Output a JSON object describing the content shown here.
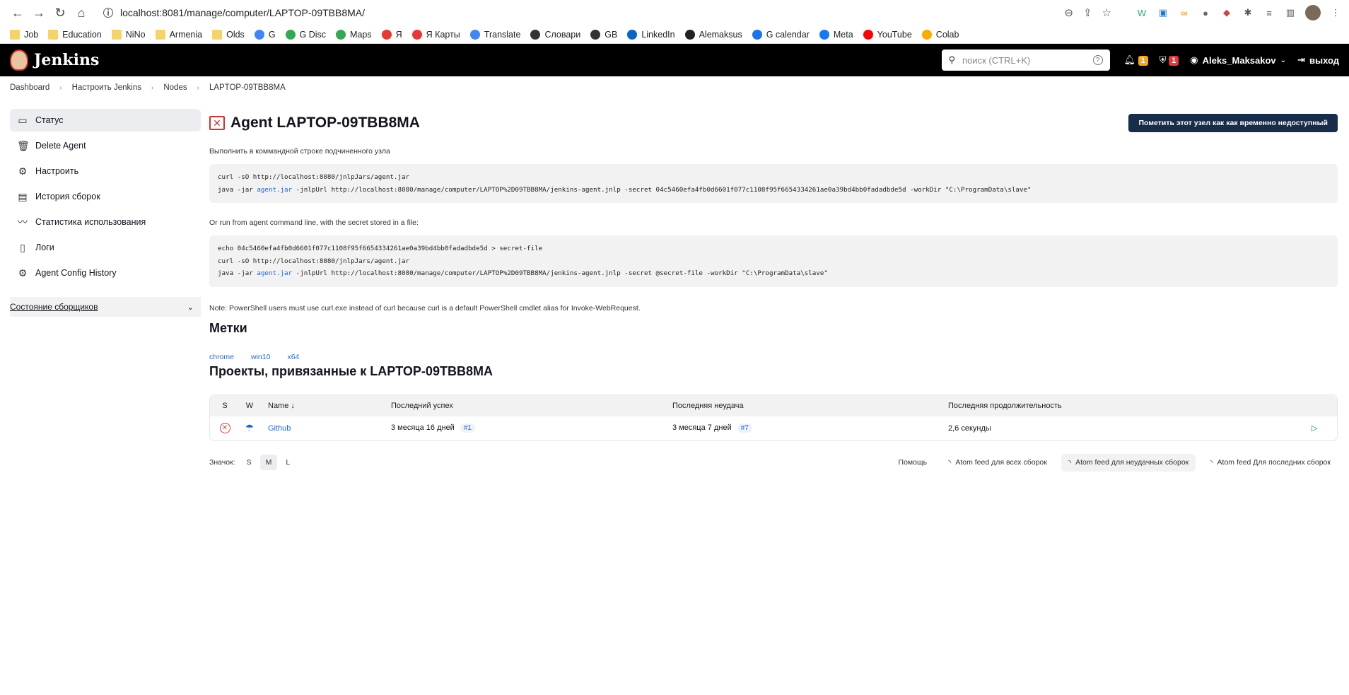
{
  "browser": {
    "url": "localhost:8081/manage/computer/LAPTOP-09TBB8MA/",
    "bookmarks": [
      "Job",
      "Education",
      "NiNo",
      "Armenia",
      "Olds",
      "G",
      "G Disc",
      "Maps",
      "Я",
      "Я Карты",
      "Translate",
      "Словари",
      "GB",
      "LinkedIn",
      "Alemaksus",
      "G calendar",
      "Meta",
      "YouTube",
      "Colab"
    ]
  },
  "header": {
    "app_name": "Jenkins",
    "search_placeholder": "поиск (CTRL+K)",
    "notifications_count": "1",
    "security_count": "1",
    "user": "Aleks_Maksakov",
    "logout": "выход"
  },
  "breadcrumb": [
    "Dashboard",
    "Настроить Jenkins",
    "Nodes",
    "LAPTOP-09TBB8MA"
  ],
  "sidebar": {
    "items": [
      {
        "label": "Статус",
        "icon": "monitor-icon"
      },
      {
        "label": "Delete Agent",
        "icon": "trash-icon"
      },
      {
        "label": "Настроить",
        "icon": "gear-icon"
      },
      {
        "label": "История сборок",
        "icon": "history-icon"
      },
      {
        "label": "Статистика использования",
        "icon": "chart-icon"
      },
      {
        "label": "Логи",
        "icon": "clipboard-icon"
      },
      {
        "label": "Agent Config History",
        "icon": "config-history-icon"
      }
    ],
    "executors_panel": "Состояние сборщиков"
  },
  "main": {
    "title": "Agent LAPTOP-09TBB8MA",
    "mark_offline_button": "Пометить этот узел как как временно недоступный",
    "run_text": "Выполнить в коммандной строке подчиненного узла",
    "code1_line1": "curl -sO http://localhost:8080/jnlpJars/agent.jar",
    "code1_line2_pre": "java -jar ",
    "code1_line2_link": "agent.jar",
    "code1_line2_post": " -jnlpUrl http://localhost:8080/manage/computer/LAPTOP%2D09TBB8MA/jenkins-agent.jnlp -secret 04c5460efa4fb0d6601f077c1108f95f6654334261ae0a39bd4bb0fadadbde5d -workDir \"C:\\ProgramData\\slave\"",
    "secret_text": "Or run from agent command line, with the secret stored in a file:",
    "code2_line1": "echo 04c5460efa4fb0d6601f077c1108f95f6654334261ae0a39bd4bb0fadadbde5d > secret-file",
    "code2_line2": "curl -sO http://localhost:8080/jnlpJars/agent.jar",
    "code2_line3_pre": "java -jar ",
    "code2_line3_link": "agent.jar",
    "code2_line3_post": " -jnlpUrl http://localhost:8080/manage/computer/LAPTOP%2D09TBB8MA/jenkins-agent.jnlp -secret @secret-file -workDir \"C:\\ProgramData\\slave\"",
    "note": "Note: PowerShell users must use curl.exe instead of curl because curl is a default PowerShell cmdlet alias for Invoke-WebRequest.",
    "labels_title": "Метки",
    "labels": [
      "chrome",
      "win10",
      "x64"
    ],
    "projects_title": "Проекты, привязанные к LAPTOP-09TBB8MA"
  },
  "table": {
    "headers": {
      "s": "S",
      "w": "W",
      "name": "Name ↓",
      "last_success": "Последний успех",
      "last_failure": "Последняя неудача",
      "last_duration": "Последняя продолжительность"
    },
    "rows": [
      {
        "name": "Github",
        "last_success": "3 месяца 16 дней",
        "success_build": "#1",
        "last_failure": "3 месяца 7 дней",
        "failure_build": "#7",
        "duration": "2,6 секунды"
      }
    ]
  },
  "footer": {
    "icon_label": "Значок:",
    "sizes": [
      "S",
      "M",
      "L"
    ],
    "help": "Помощь",
    "feed_all": "Atom feed для всех сборок",
    "feed_failed": "Atom feed для неудачных сборок",
    "feed_latest": "Atom feed Для последних сборок"
  }
}
